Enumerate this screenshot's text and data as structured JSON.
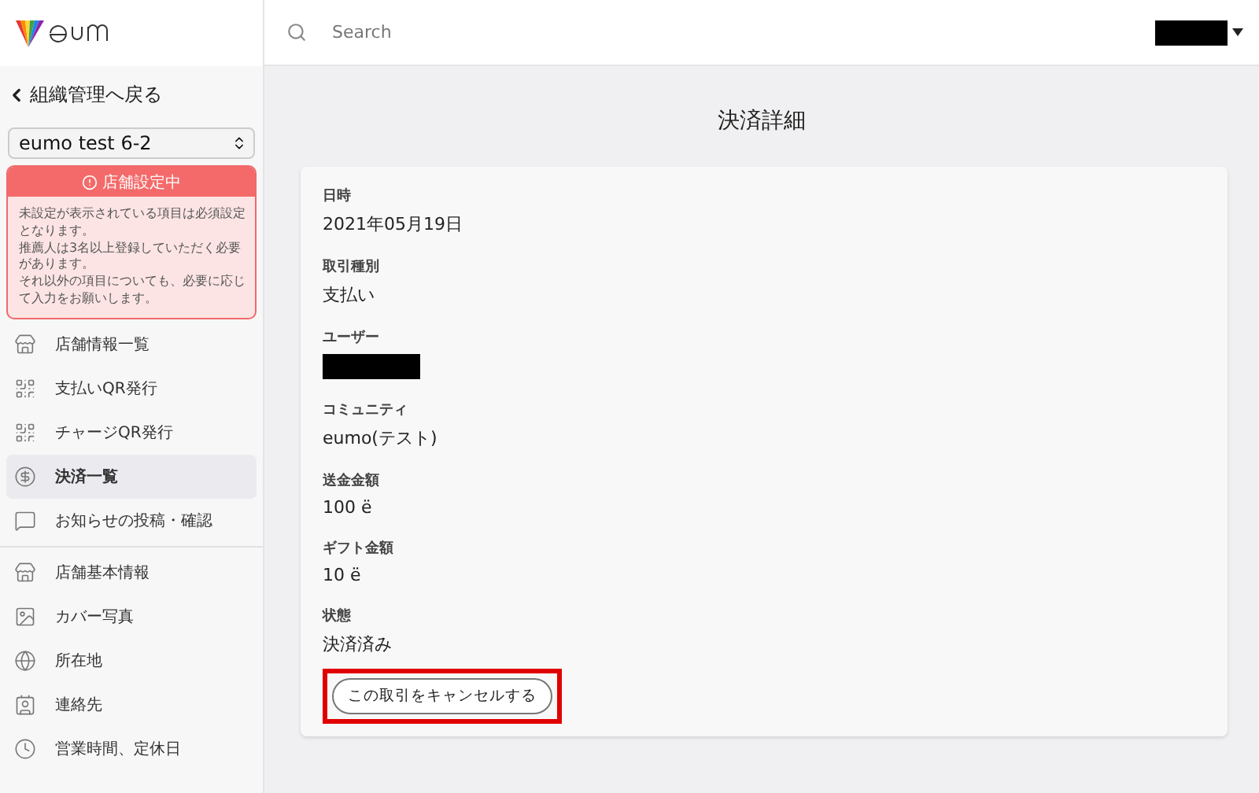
{
  "sidebar": {
    "back_link": "組織管理へ戻る",
    "store_select": "eumo test 6-2",
    "alert": {
      "title": "店舗設定中",
      "body": [
        "未設定が表示されている項目は必須設定となります。",
        "推薦人は3名以上登録していただく必要があります。",
        "それ以外の項目についても、必要に応じて入力をお願いします。"
      ]
    },
    "groups": [
      [
        {
          "label": "店舗情報一覧",
          "selected": false
        },
        {
          "label": "支払いQR発行",
          "selected": false
        },
        {
          "label": "チャージQR発行",
          "selected": false
        },
        {
          "label": "決済一覧",
          "selected": true
        },
        {
          "label": "お知らせの投稿・確認",
          "selected": false
        }
      ],
      [
        {
          "label": "店舗基本情報",
          "selected": false
        },
        {
          "label": "カバー写真",
          "selected": false
        },
        {
          "label": "所在地",
          "selected": false
        },
        {
          "label": "連絡先",
          "selected": false
        },
        {
          "label": "営業時間、定休日",
          "selected": false
        }
      ]
    ]
  },
  "search": {
    "placeholder": "Search"
  },
  "page_title": "決済詳細",
  "fields": [
    {
      "label": "日時",
      "value": "2021年05月19日",
      "kind": "text"
    },
    {
      "label": "取引種別",
      "value": "支払い",
      "kind": "text"
    },
    {
      "label": "ユーザー",
      "kind": "redacted"
    },
    {
      "label": "コミュニティ",
      "value": "eumo(テスト)",
      "kind": "text"
    },
    {
      "label": "送金金額",
      "value": "100 ë",
      "kind": "text"
    },
    {
      "label": "ギフト金額",
      "value": "10 ë",
      "kind": "text"
    },
    {
      "label": "状態",
      "value": "決済済み",
      "kind": "text"
    }
  ],
  "cancel_button": "この取引をキャンセルする"
}
